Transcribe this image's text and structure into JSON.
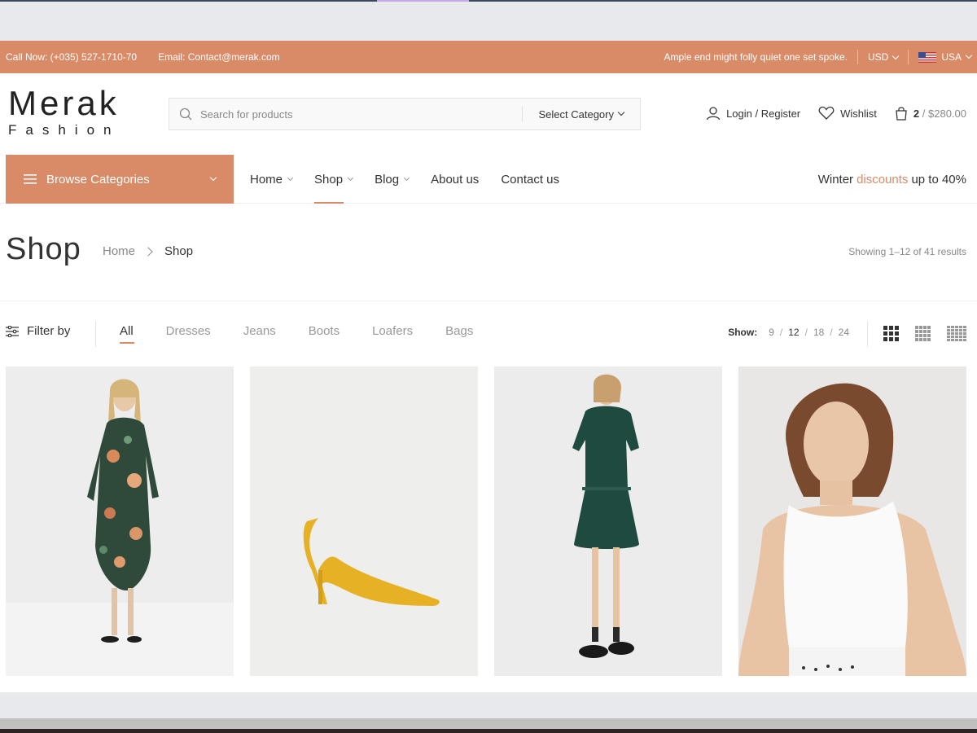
{
  "topbar": {
    "phone": "Call Now: (+035) 527-1710-70",
    "email": "Email: Contact@merak.com",
    "tagline": "Ample end might folly quiet one set spoke.",
    "currency": "USD",
    "country": "USA"
  },
  "header": {
    "logo_line1": "Merak",
    "logo_line2": "Fashion",
    "search_placeholder": "Search for products",
    "select_category": "Select Category",
    "login": "Login / Register",
    "wishlist": "Wishlist",
    "cart_count": "2",
    "cart_total": "/ $280.00"
  },
  "nav": {
    "browse": "Browse Categories",
    "items": [
      {
        "label": "Home"
      },
      {
        "label": "Shop"
      },
      {
        "label": "Blog"
      },
      {
        "label": "About us"
      },
      {
        "label": "Contact us"
      }
    ],
    "promo_before": "Winter",
    "promo_highlight": "discounts",
    "promo_after": "up to 40%"
  },
  "page": {
    "title": "Shop",
    "breadcrumb_home": "Home",
    "breadcrumb_current": "Shop",
    "results": "Showing 1–12 of 41 results"
  },
  "filters": {
    "filter_by": "Filter by",
    "categories": [
      "All",
      "Dresses",
      "Jeans",
      "Boots",
      "Loafers",
      "Bags"
    ],
    "show_label": "Show:",
    "show_options": [
      "9",
      "12",
      "18",
      "24"
    ],
    "show_selected": "12"
  },
  "products": [
    {
      "image": "floral-dress-model"
    },
    {
      "image": "yellow-heel-shoe"
    },
    {
      "image": "green-lace-dress-model"
    },
    {
      "image": "white-top-model"
    }
  ],
  "colors": {
    "accent": "#d98a66",
    "text": "#333333",
    "muted": "#888888"
  }
}
